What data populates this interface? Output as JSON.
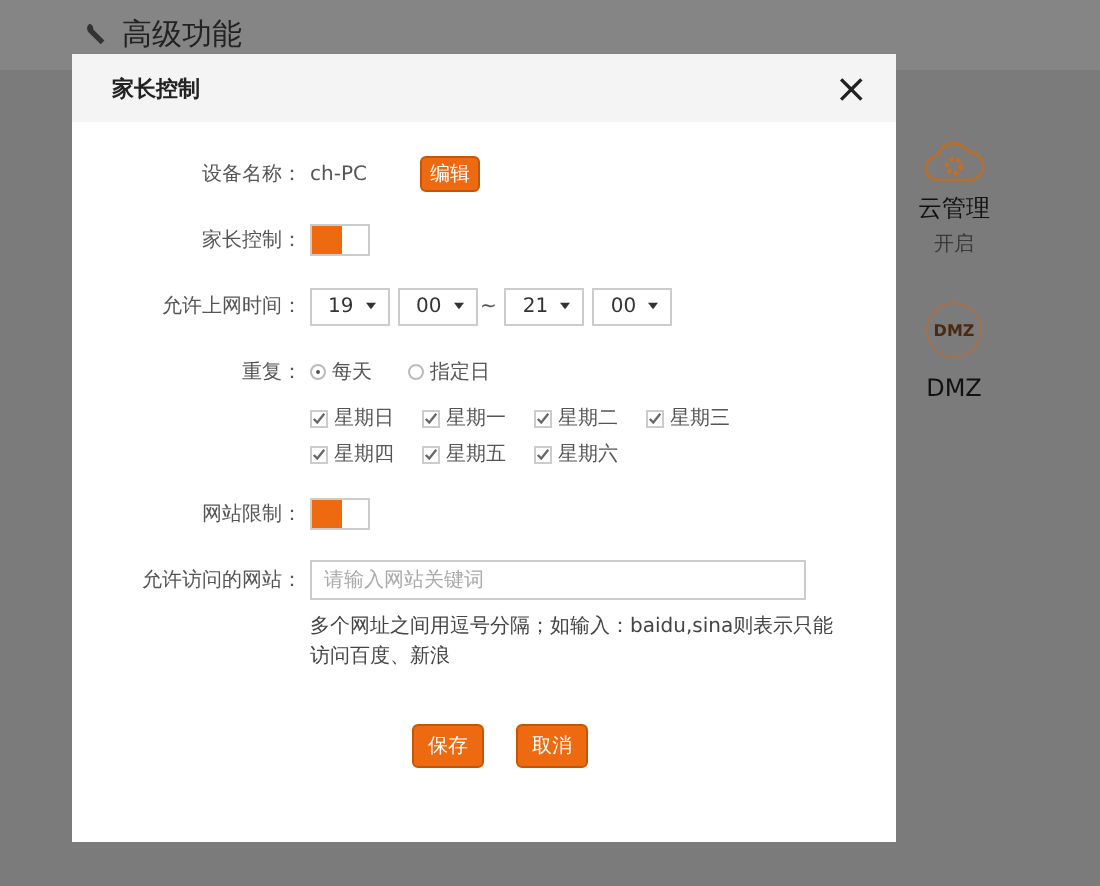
{
  "page": {
    "title": "高级功能",
    "tiles": [
      {
        "kind": "cloud",
        "label": "云管理",
        "status": "开启"
      },
      {
        "kind": "dmz",
        "label": "DMZ",
        "icon_text": "DMZ"
      }
    ]
  },
  "dialog": {
    "title": "家长控制",
    "close": "×",
    "device": {
      "label": "设备名称：",
      "value": "ch-PC",
      "button": "编辑"
    },
    "parental_control": {
      "label": "家长控制：",
      "on": true
    },
    "time": {
      "label": "允许上网时间：",
      "start_hour": "19",
      "start_minute": "00",
      "separator": "~",
      "end_hour": "21",
      "end_minute": "00"
    },
    "repeat": {
      "label": "重复：",
      "options": [
        {
          "label": "每天",
          "selected": true
        },
        {
          "label": "指定日",
          "selected": false
        }
      ],
      "days": [
        {
          "label": "星期日",
          "checked": true
        },
        {
          "label": "星期一",
          "checked": true
        },
        {
          "label": "星期二",
          "checked": true
        },
        {
          "label": "星期三",
          "checked": true
        },
        {
          "label": "星期四",
          "checked": true
        },
        {
          "label": "星期五",
          "checked": true
        },
        {
          "label": "星期六",
          "checked": true
        }
      ]
    },
    "site_limit": {
      "label": "网站限制：",
      "on": true
    },
    "sites": {
      "label": "允许访问的网站：",
      "placeholder": "请输入网站关键词",
      "hint": "多个网址之间用逗号分隔；如输入：baidu,sina则表示只能访问百度、新浪"
    },
    "buttons": [
      "保存",
      "取消"
    ]
  }
}
